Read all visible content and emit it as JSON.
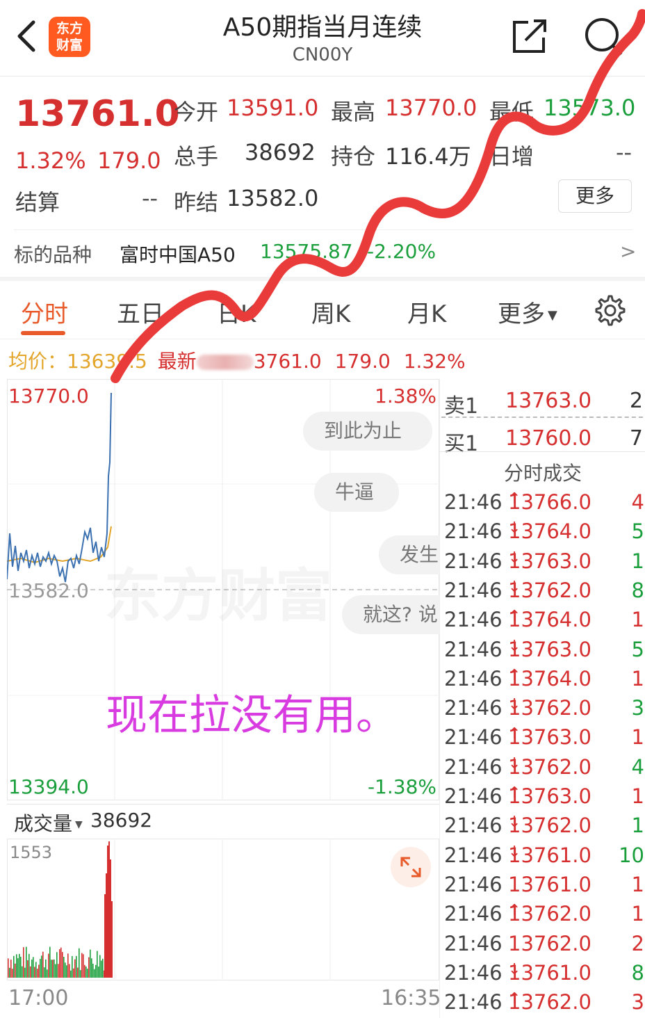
{
  "header": {
    "title": "A50期指当月连续",
    "subtitle": "CN00Y",
    "logo_text": [
      "东方",
      "财富"
    ]
  },
  "quote": {
    "price": "13761.0",
    "change_pct": "1.32%",
    "change_abs": "179.0",
    "open_label": "今开",
    "open": "13591.0",
    "high_label": "最高",
    "high": "13770.0",
    "low_label": "最低",
    "low": "13573.0",
    "volume_label": "总手",
    "volume": "38692",
    "oi_label": "持仓",
    "oi": "116.4万",
    "daily_add_label": "日增",
    "daily_add": "--",
    "settle_label": "结算",
    "settle": "--",
    "prev_settle_label": "昨结",
    "prev_settle": "13582.0",
    "more_label": "更多"
  },
  "underlying": {
    "label": "标的品种",
    "name": "富时中国A50",
    "price": "13575.87",
    "change": "-2.20%",
    "arrow": ">"
  },
  "tabs": [
    "分时",
    "五日",
    "日K",
    "周K",
    "月K",
    "更多"
  ],
  "info_line": {
    "avg_label": "均价：",
    "avg_value": "13639.5",
    "latest_label": "最新",
    "latest_value": "3761.0",
    "chg_abs": "179.0",
    "chg_pct": "1.32%"
  },
  "chart": {
    "max_price": "13770.0",
    "max_pct": "1.38%",
    "mid_price": "13582.0",
    "min_price": "13394.0",
    "min_pct": "-1.38%",
    "watermark": "东方财富"
  },
  "bubbles": [
    "到此为止",
    "牛逼",
    "发生",
    "就这?  说"
  ],
  "overlay_text": "现在拉没有用。",
  "volume": {
    "label": "成交量",
    "value": "38692",
    "max_label": "1553",
    "start_time": "17:00",
    "end_time": "16:35"
  },
  "orderbook": {
    "sell_label": "卖1",
    "sell_price": "13763.0",
    "sell_vol": "2",
    "buy_label": "买1",
    "buy_price": "13760.0",
    "buy_vol": "7",
    "trades_title": "分时成交",
    "trades": [
      {
        "time": "21:46",
        "price": "13766.0",
        "dir": "↑",
        "vol": "4"
      },
      {
        "time": "21:46",
        "price": "13764.0",
        "dir": "↓",
        "vol": "5"
      },
      {
        "time": "21:46",
        "price": "13763.0",
        "dir": "↓",
        "vol": "1"
      },
      {
        "time": "21:46",
        "price": "13762.0",
        "dir": "↓",
        "vol": "8"
      },
      {
        "time": "21:46",
        "price": "13764.0",
        "dir": "↑",
        "vol": "1"
      },
      {
        "time": "21:46",
        "price": "13763.0",
        "dir": "↓",
        "vol": "5"
      },
      {
        "time": "21:46",
        "price": "13764.0",
        "dir": "↑",
        "vol": "1"
      },
      {
        "time": "21:46",
        "price": "13762.0",
        "dir": "↓",
        "vol": "3"
      },
      {
        "time": "21:46",
        "price": "13763.0",
        "dir": "↑",
        "vol": "1"
      },
      {
        "time": "21:46",
        "price": "13762.0",
        "dir": "↓",
        "vol": "4"
      },
      {
        "time": "21:46",
        "price": "13763.0",
        "dir": "↑",
        "vol": "1"
      },
      {
        "time": "21:46",
        "price": "13762.0",
        "dir": "↓",
        "vol": "1"
      },
      {
        "time": "21:46",
        "price": "13761.0",
        "dir": "↓",
        "vol": "10"
      },
      {
        "time": "21:46",
        "price": "13761.0",
        "dir": "",
        "vol": "1"
      },
      {
        "time": "21:46",
        "price": "13762.0",
        "dir": "↑",
        "vol": "1"
      },
      {
        "time": "21:46",
        "price": "13762.0",
        "dir": "",
        "vol": "2"
      },
      {
        "time": "21:46",
        "price": "13761.0",
        "dir": "↓",
        "vol": "8"
      },
      {
        "time": "21:46",
        "price": "13762.0",
        "dir": "↑",
        "vol": "3"
      }
    ]
  },
  "colors": {
    "up": "#d62f2f",
    "down": "#1a9f3c",
    "accent": "#e85a2a",
    "price_line": "#3a6fb0",
    "avg_line": "#e3a52a",
    "overlay": "#d83ce0",
    "arrow": "#ea3b3b"
  },
  "icons": [
    "back-chevron-icon",
    "share-icon",
    "search-icon",
    "settings-gear-icon",
    "expand-icon",
    "dropdown-caret-icon"
  ]
}
